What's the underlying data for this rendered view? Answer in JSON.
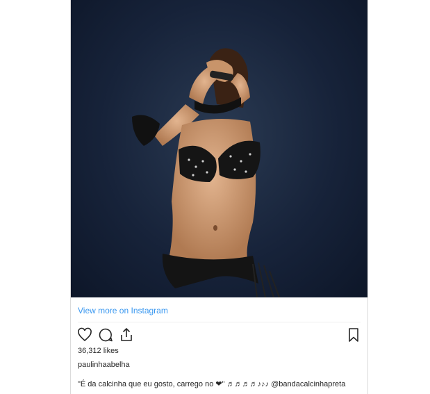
{
  "post": {
    "view_more_label": "View more on Instagram",
    "likes": "36,312 likes",
    "author": "paulinhaabelha",
    "caption_text": "\"É da calcinha que eu gosto, carrego no ❤\" ♬♬♬♬♪♪♪",
    "caption_mention": "@bandacalcinhapreta"
  },
  "icons": {
    "like": "heart-outline-icon",
    "comment": "comment-bubble-icon",
    "share": "share-upload-icon",
    "save": "bookmark-icon"
  },
  "colors": {
    "link": "#3897f0",
    "text": "#262626",
    "media_bg": "#17233a"
  }
}
